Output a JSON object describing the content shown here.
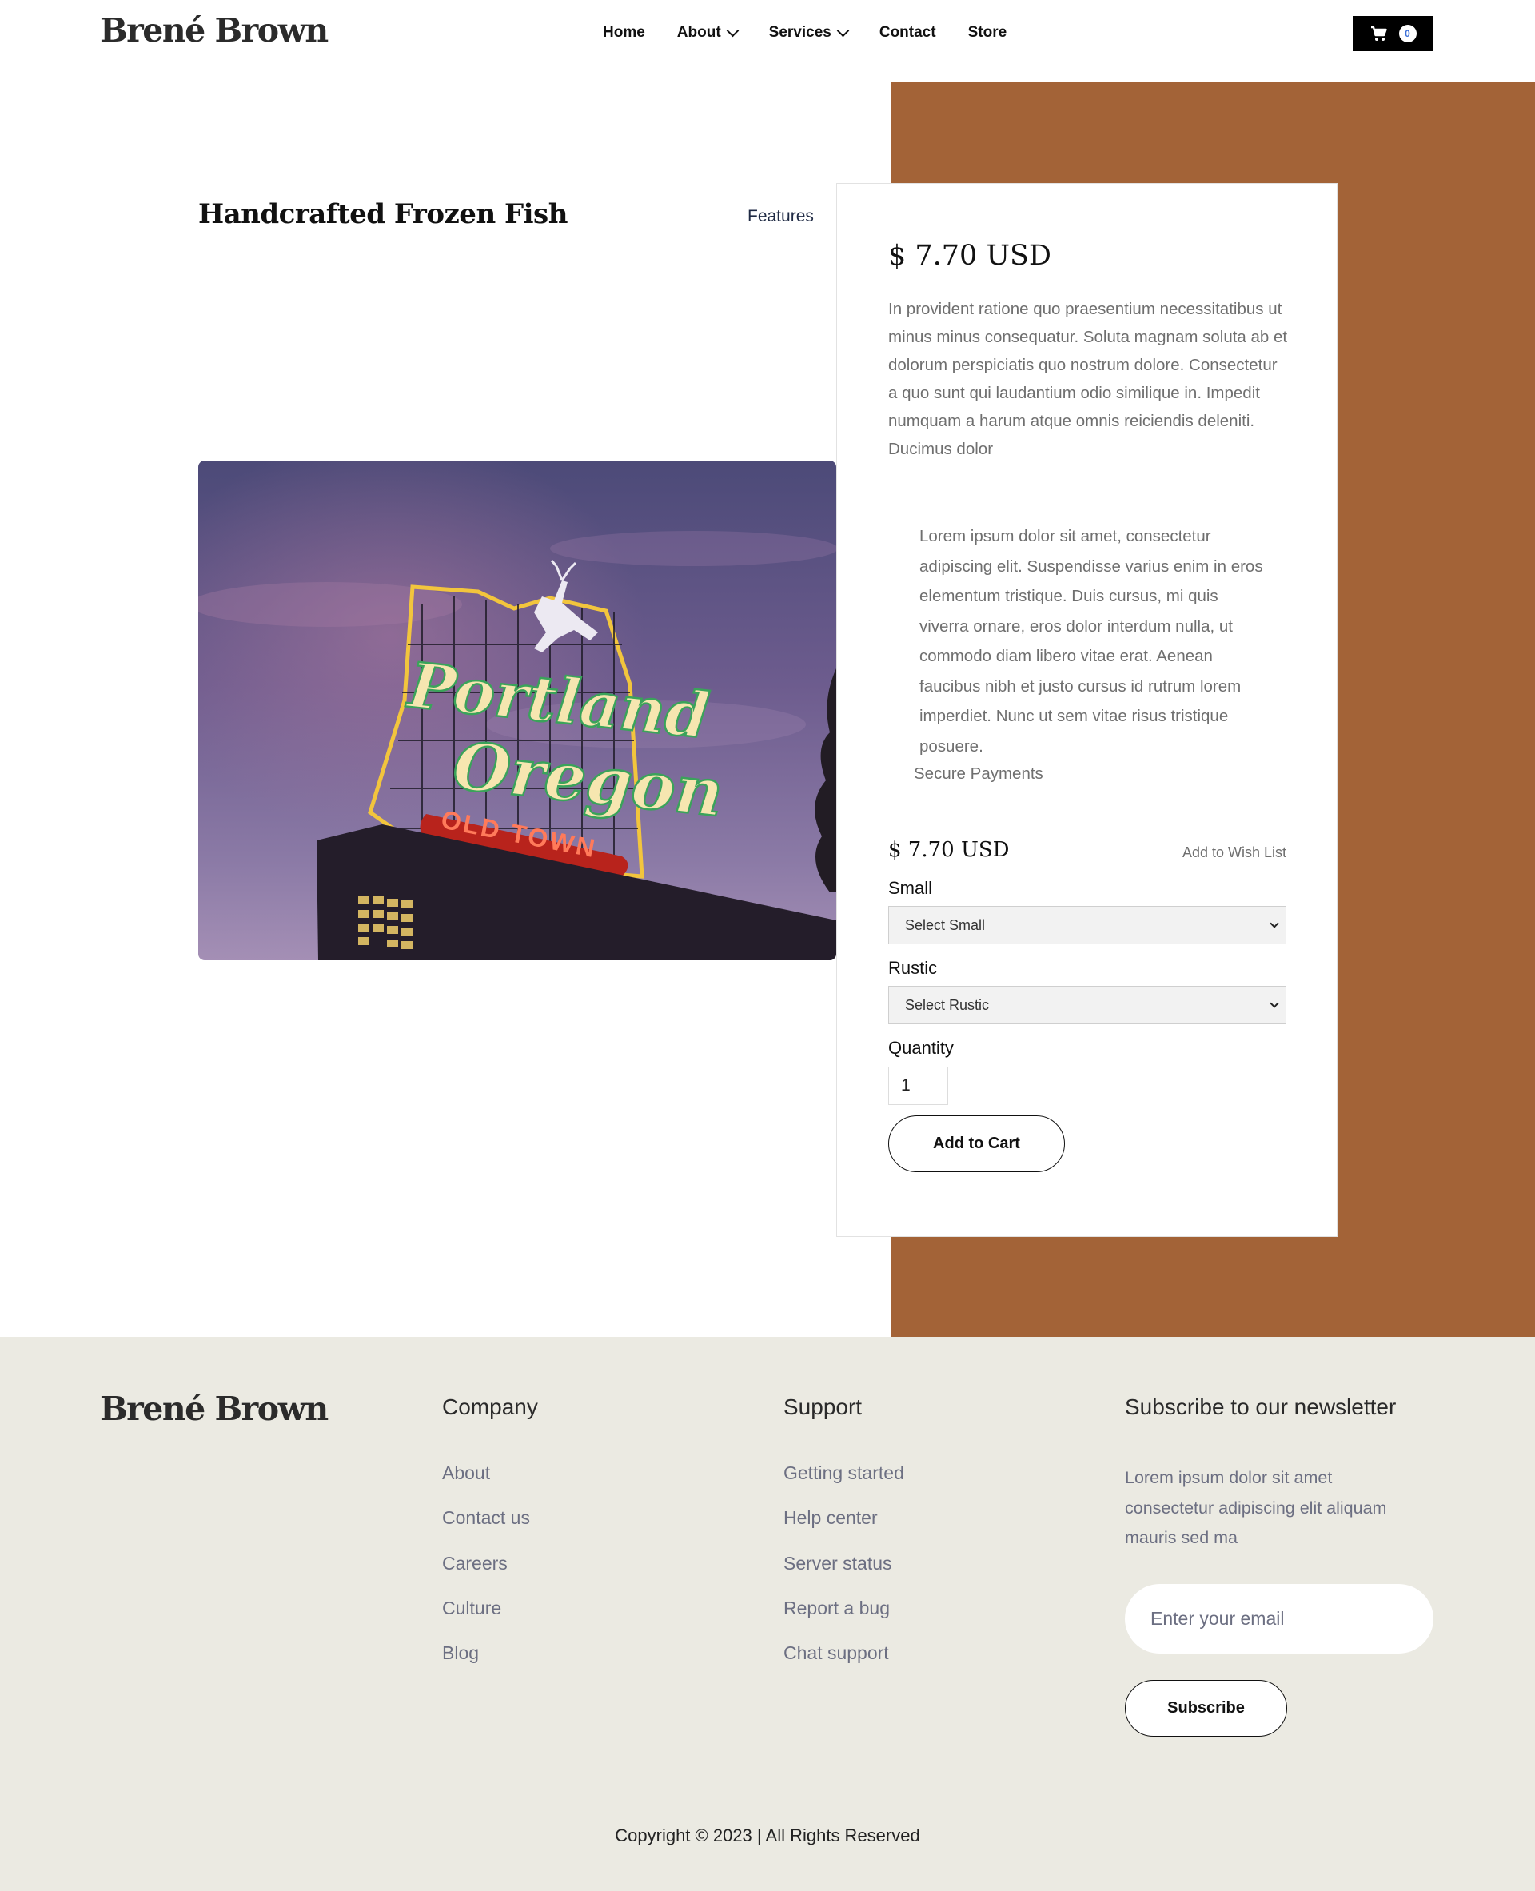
{
  "header": {
    "logo": "Brené Brown",
    "nav": [
      {
        "label": "Home"
      },
      {
        "label": "About"
      },
      {
        "label": "Services"
      },
      {
        "label": "Contact"
      },
      {
        "label": "Store"
      }
    ],
    "cart_count": "0"
  },
  "product": {
    "title": "Handcrafted Frozen Fish",
    "features_label": "Features",
    "image_text": {
      "line1": "Portland",
      "line2": "Oregon",
      "line3": "OLD TOWN"
    },
    "price": "$ 7.70 USD",
    "description": "In provident ratione quo praesentium necessitatibus ut minus minus consequatur. Soluta magnam soluta ab et dolorum perspiciatis quo nostrum dolore. Consectetur a quo sunt qui laudantium odio similique in. Impedit numquam a harum atque omnis reiciendis deleniti. Ducimus dolor",
    "details": "Lorem ipsum dolor sit amet, consectetur adipiscing elit. Suspendisse varius enim in eros elementum tristique. Duis cursus, mi quis viverra ornare, eros dolor interdum nulla, ut commodo diam libero vitae erat. Aenean faucibus nibh et justo cursus id rutrum lorem imperdiet. Nunc ut sem vitae risus tristique posuere.",
    "secure_payments": "Secure Payments",
    "price_small": "$ 7.70 USD",
    "wishlist_label": "Add to Wish List",
    "options": [
      {
        "label": "Small",
        "selected": "Select Small"
      },
      {
        "label": "Rustic",
        "selected": "Select Rustic"
      }
    ],
    "quantity_label": "Quantity",
    "quantity_value": "1",
    "add_to_cart_label": "Add to Cart"
  },
  "footer": {
    "logo": "Brené Brown",
    "company": {
      "title": "Company",
      "links": [
        "About",
        "Contact us",
        "Careers",
        "Culture",
        "Blog"
      ]
    },
    "support": {
      "title": "Support",
      "links": [
        "Getting started",
        "Help center",
        "Server status",
        "Report a bug",
        "Chat support"
      ]
    },
    "newsletter": {
      "title": "Subscribe to our newsletter",
      "description": "Lorem ipsum dolor sit amet consectetur adipiscing elit aliquam mauris sed ma",
      "email_placeholder": "Enter your email",
      "subscribe_label": "Subscribe"
    },
    "copyright": "Copyright © 2023 | All Rights Reserved"
  },
  "colors": {
    "accent_brown": "#a36337",
    "footer_bg": "#ebeae2",
    "muted_text": "#6f6f6f",
    "link_text": "#6c6f82"
  }
}
